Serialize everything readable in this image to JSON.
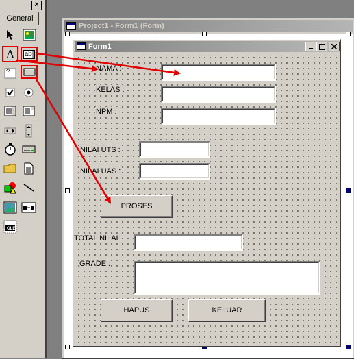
{
  "toolbox": {
    "close_label": "×",
    "header_label": "General",
    "tools": [
      {
        "name": "pointer-icon"
      },
      {
        "name": "picturebox-icon"
      },
      {
        "name": "label-tool-icon",
        "glyph": "A"
      },
      {
        "name": "textbox-tool-icon",
        "glyph": "ab|"
      },
      {
        "name": "frame-tool-icon",
        "glyph": "xy"
      },
      {
        "name": "commandbutton-tool-icon"
      },
      {
        "name": "checkbox-tool-icon"
      },
      {
        "name": "optionbutton-tool-icon"
      },
      {
        "name": "combobox-tool-icon"
      },
      {
        "name": "listbox-tool-icon"
      },
      {
        "name": "hscrollbar-tool-icon"
      },
      {
        "name": "vscrollbar-tool-icon"
      },
      {
        "name": "timer-tool-icon"
      },
      {
        "name": "drivelistbox-tool-icon"
      },
      {
        "name": "dirlistbox-tool-icon"
      },
      {
        "name": "filelistbox-tool-icon"
      },
      {
        "name": "shape-tool-icon"
      },
      {
        "name": "line-tool-icon"
      },
      {
        "name": "image-tool-icon"
      },
      {
        "name": "data-tool-icon"
      },
      {
        "name": "ole-tool-icon",
        "glyph": "OLE"
      }
    ]
  },
  "project_window": {
    "title": "Project1 - Form1 (Form)"
  },
  "form": {
    "title": "Form1",
    "labels": {
      "nama": "NAMA :",
      "kelas": "KELAS :",
      "npm": "NPM  :",
      "nilai_uts": "NILAI UTS :",
      "nilai_uas": "NILAI UAS :",
      "total_nilai": "TOTAL NILAI",
      "grade": "GRADE :"
    },
    "buttons": {
      "proses": "PROSES",
      "hapus": "HAPUS",
      "keluar": "KELUAR"
    }
  },
  "colors": {
    "annotation_red": "#e00000",
    "face": "#d4d0c8",
    "title_gradient_start": "#808080"
  }
}
